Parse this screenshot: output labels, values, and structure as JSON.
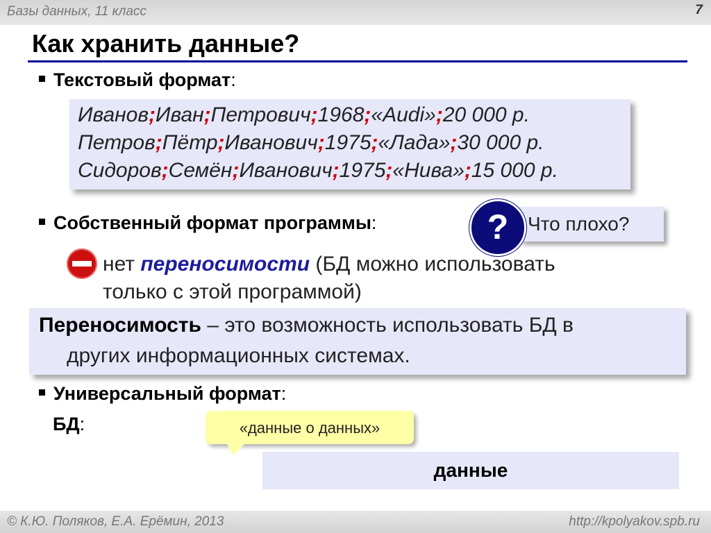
{
  "header": {
    "course": "Базы данных, 11 класс",
    "page_number": "7"
  },
  "title": "Как хранить данные?",
  "section_text_format": {
    "label": "Текстовый формат",
    "suffix": ":"
  },
  "text_records": [
    {
      "f1": "Иванов",
      "f2": "Иван",
      "f3": "Петрович",
      "f4": "1968",
      "f5": "«Audi»",
      "f6": "20 000 р."
    },
    {
      "f1": "Петров",
      "f2": "Пётр",
      "f3": "Иванович",
      "f4": "1975",
      "f5": "«Лада»",
      "f6": "30 000 р."
    },
    {
      "f1": "Сидоров",
      "f2": "Семён",
      "f3": "Иванович",
      "f4": "1975",
      "f5": "«Нива»",
      "f6": "15 000 р."
    }
  ],
  "separator": ";",
  "section_own_format": {
    "label": "Собственный формат программы",
    "suffix": ":"
  },
  "question": {
    "symbol": "?",
    "text": "Что плохо?"
  },
  "drawback": {
    "prefix": "нет ",
    "keyword": "переносимости",
    "rest": " (БД можно использовать",
    "line2": "только с этой программой)"
  },
  "definition": {
    "term": "Переносимость",
    "line1_rest": " – это возможность использовать БД в",
    "line2": "других информационных системах."
  },
  "section_universal": {
    "label": "Универсальный формат",
    "suffix": ":"
  },
  "db_label": {
    "label": "БД",
    "suffix": ":"
  },
  "metadata_callout": "«данные о данных»",
  "data_box": "данные",
  "footer": {
    "authors": "© К.Ю. Поляков, Е.А. Ерёмин, 2013",
    "site": "http://kpolyakov.spb.ru"
  },
  "colors": {
    "separator": "#cc0000",
    "title_rule": "#000099",
    "box_fill": "#e7e7fa",
    "callout_fill": "#ffffa6",
    "keyword": "#1c1c9e"
  }
}
